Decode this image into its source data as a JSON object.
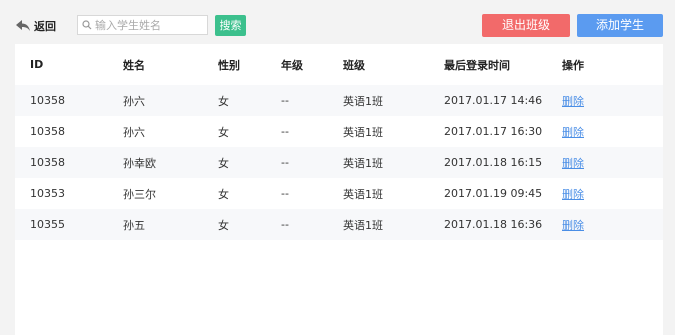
{
  "toolbar": {
    "back_label": "返回",
    "search_placeholder": "输入学生姓名",
    "search_value": "",
    "search_button": "搜索",
    "exit_class_button": "退出班级",
    "add_student_button": "添加学生"
  },
  "colors": {
    "search_button": "#3cc08d",
    "exit_button": "#f26a6a",
    "add_button": "#5b9bf0",
    "delete_link": "#4a8ee6"
  },
  "table": {
    "headers": {
      "id": "ID",
      "name": "姓名",
      "sex": "性别",
      "grade": "年级",
      "class": "班级",
      "last_login": "最后登录时间",
      "action": "操作"
    },
    "rows": [
      {
        "id": "10358",
        "name": "孙六",
        "sex": "女",
        "grade": "--",
        "class": "英语1班",
        "last_login": "2017.01.17 14:46",
        "action": "删除"
      },
      {
        "id": "10358",
        "name": "孙六",
        "sex": "女",
        "grade": "--",
        "class": "英语1班",
        "last_login": "2017.01.17 16:30",
        "action": "删除"
      },
      {
        "id": "10358",
        "name": "孙幸欧",
        "sex": "女",
        "grade": "--",
        "class": "英语1班",
        "last_login": "2017.01.18 16:15",
        "action": "删除"
      },
      {
        "id": "10353",
        "name": "孙三尔",
        "sex": "女",
        "grade": "--",
        "class": "英语1班",
        "last_login": "2017.01.19 09:45",
        "action": "删除"
      },
      {
        "id": "10355",
        "name": "孙五",
        "sex": "女",
        "grade": "--",
        "class": "英语1班",
        "last_login": "2017.01.18 16:36",
        "action": "删除"
      }
    ]
  }
}
